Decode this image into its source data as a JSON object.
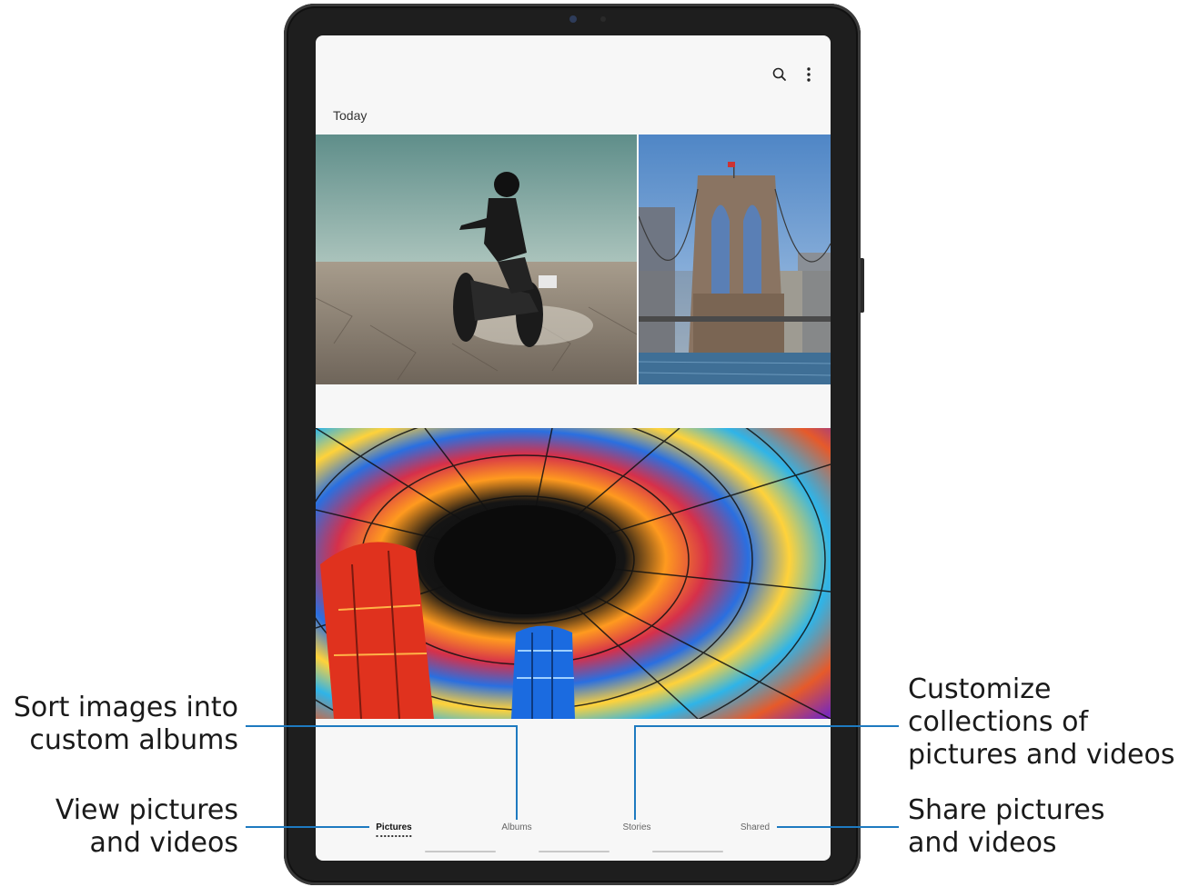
{
  "app": {
    "section_title": "Today",
    "icons": {
      "search": "search-icon",
      "more": "more-options-icon"
    }
  },
  "photos": [
    {
      "name": "motorcycle-photo",
      "subject": "motorcycle"
    },
    {
      "name": "bridge-photo",
      "subject": "bridge"
    },
    {
      "name": "stained-glass-dome-photo",
      "subject": "dome"
    }
  ],
  "bottom_nav": {
    "tabs": [
      {
        "label": "Pictures",
        "active": true
      },
      {
        "label": "Albums",
        "active": false
      },
      {
        "label": "Stories",
        "active": false
      },
      {
        "label": "Shared",
        "active": false
      }
    ]
  },
  "callouts": {
    "albums": {
      "line1": "Sort images into",
      "line2": "custom albums"
    },
    "pictures": {
      "line1": "View pictures",
      "line2": "and videos"
    },
    "stories": {
      "line1": "Customize",
      "line2": "collections of",
      "line3": "pictures and videos"
    },
    "shared": {
      "line1": "Share pictures",
      "line2": "and videos"
    }
  },
  "colors": {
    "accent_line": "#1e7ac0",
    "frame": "#1e1e1e",
    "screen_bg": "#f7f7f7"
  }
}
